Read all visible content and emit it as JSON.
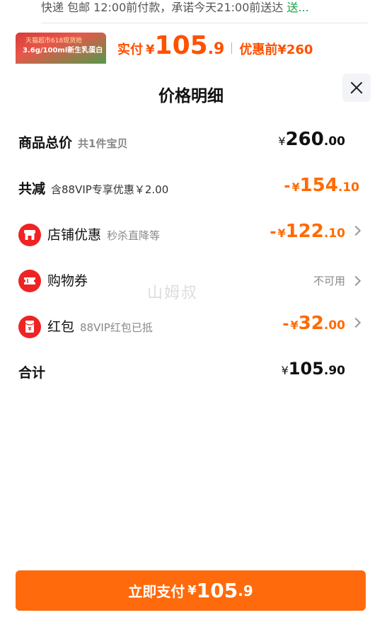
{
  "background": {
    "delivery_text": "快递 包邮 12:00前付款，承诺今天21:00前送达",
    "delivery_more": "送...",
    "thumb_top": "天猫超市618现货抢",
    "thumb_main": "3.6g/100ml新生乳蛋白",
    "paid_label": "实付",
    "currency": "¥",
    "paid_int": "105",
    "paid_dec": ".9",
    "before_label": "优惠前",
    "before_amount": "¥260"
  },
  "sheet": {
    "title": "价格明细",
    "close_label": "关闭"
  },
  "rows": {
    "total": {
      "label": "商品总价",
      "sub": "共1件宝贝",
      "yen": "¥",
      "int": "260",
      "dec": ".00"
    },
    "reduce": {
      "label": "共减",
      "sub": "含88VIP专享优惠￥2.00",
      "minus": "-",
      "yen": "¥",
      "int": "154",
      "dec": ".10"
    },
    "store": {
      "label": "店铺优惠",
      "sub": "秒杀直降等",
      "minus": "-",
      "yen": "¥",
      "int": "122",
      "dec": ".10"
    },
    "coupon": {
      "label": "购物券",
      "value": "不可用"
    },
    "redpacket": {
      "label": "红包",
      "sub": "88VIP红包已抵",
      "minus": "-",
      "yen": "¥",
      "int": "32",
      "dec": ".00"
    },
    "sum": {
      "label": "合计",
      "yen": "¥",
      "int": "105",
      "dec": ".90"
    }
  },
  "watermark": "山姆叔",
  "pay_button": {
    "label": "立即支付",
    "yen": "¥",
    "int": "105",
    "dec": ".9"
  },
  "colors": {
    "accent": "#ff6a0c",
    "discount": "#ff6a00",
    "icon_red": "#ef2323"
  }
}
